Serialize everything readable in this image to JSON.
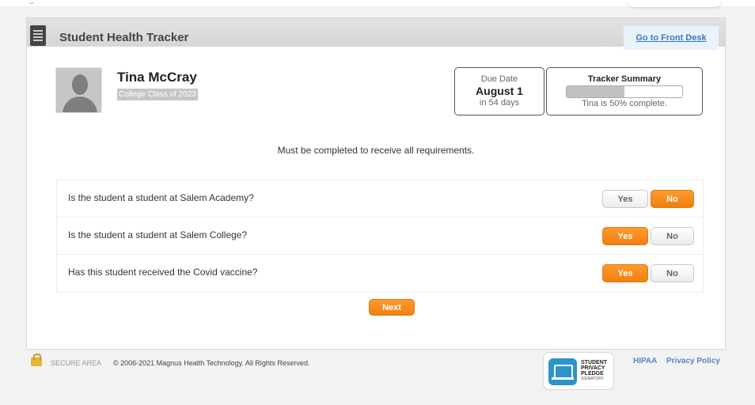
{
  "header": {
    "title": "Student Health Tracker",
    "front_desk_link": "Go to Front Desk"
  },
  "student": {
    "name": "Tina McCray",
    "class_label": "College Class of 2023"
  },
  "due": {
    "label": "Due Date",
    "date": "August 1",
    "remaining": "in 54 days"
  },
  "summary": {
    "title": "Tracker Summary",
    "progress_percent": 50,
    "status_text": "Tina is 50% complete."
  },
  "notice": "Must be completed to receive all requirements.",
  "questions": [
    {
      "text": "Is the student a student at Salem Academy?",
      "yes_label": "Yes",
      "no_label": "No",
      "selected": "No"
    },
    {
      "text": "Is the student a student at Salem College?",
      "yes_label": "Yes",
      "no_label": "No",
      "selected": "Yes"
    },
    {
      "text": "Has this student received the Covid vaccine?",
      "yes_label": "Yes",
      "no_label": "No",
      "selected": "Yes"
    }
  ],
  "next_label": "Next",
  "footer": {
    "secure_area": "SECURE AREA",
    "copyright": "© 2006-2021 Magnus Health Technology. All Rights Reserved.",
    "pledge_line1": "STUDENT",
    "pledge_line2": "PRIVACY",
    "pledge_line3": "PLEDGE",
    "pledge_line4": "SIGNATORY",
    "hipaa": "HIPAA",
    "privacy_policy": "Privacy Policy"
  },
  "colors": {
    "accent": "#f58a1f",
    "link": "#3a78c0",
    "header_bg": "#d9d9d9"
  },
  "icons": {
    "document": "document-icon",
    "avatar": "person-silhouette-icon",
    "lock": "lock-icon",
    "pledge": "laptop-icon"
  }
}
